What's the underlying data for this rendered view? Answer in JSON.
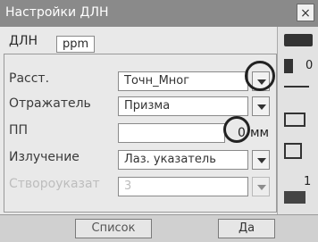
{
  "window": {
    "title": "Настройки ДЛН",
    "close_symbol": "×"
  },
  "tabs": [
    {
      "label": "ДЛН"
    },
    {
      "label": "ppm"
    }
  ],
  "form": {
    "rows": [
      {
        "label": "Расст.",
        "value": "Точн_Мног",
        "has_dropdown": true
      },
      {
        "label": "Отражатель",
        "value": "Призма",
        "has_dropdown": true
      },
      {
        "label": "ПП",
        "value": "",
        "unit": "мм",
        "unit_prefix": "0"
      },
      {
        "label": "Излучение",
        "value": "Лаз. указатель",
        "has_dropdown": true
      },
      {
        "label": "Створоуказат",
        "value": "3",
        "has_dropdown": true,
        "disabled": true
      }
    ]
  },
  "softkeys": {
    "list": "Список",
    "ok": "Да"
  },
  "side_panel": {
    "value_1": "0",
    "value_2": "1"
  },
  "colors": {
    "titlebar": "#8a8a8a",
    "field_bg": "#ffffff",
    "panel_bg": "#e9e9e9"
  }
}
